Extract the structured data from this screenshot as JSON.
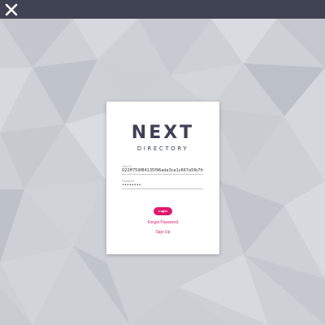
{
  "brand": {
    "word": "NEXT",
    "subtitle": "DIRECTORY"
  },
  "form": {
    "user_id_label": "User ID",
    "user_id_value": "022ff759f84135f96ada3ca1c667a5fb7fd",
    "password_label": "Password",
    "password_value": "••••••••",
    "login_label": "Login",
    "forgot_label": "Forgot Password",
    "signup_label": "Sign Up"
  },
  "colors": {
    "topbar": "#3f4252",
    "accent": "#e0176c",
    "brand_text": "#3c4155"
  },
  "icons": {
    "app_logo": "x-logo-icon"
  }
}
